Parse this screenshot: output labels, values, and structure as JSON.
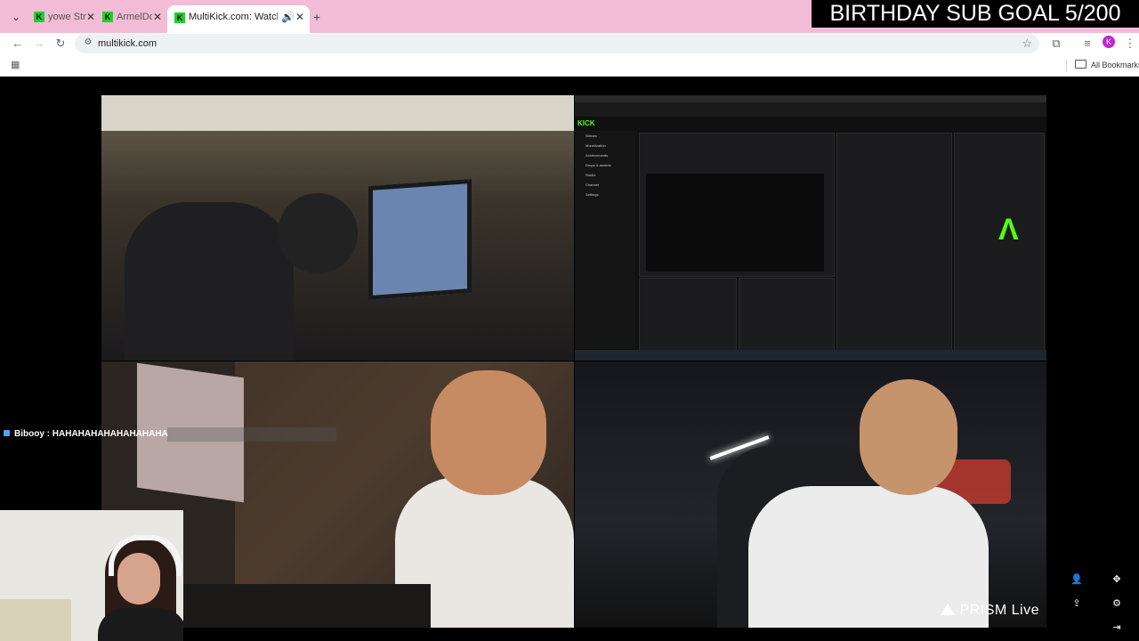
{
  "browser": {
    "tabs": [
      {
        "title": "yowe Str",
        "favicon": "K",
        "active": false
      },
      {
        "title": "ArmelDo",
        "favicon": "K",
        "active": false
      },
      {
        "title": "MultiKick.com: Watch Multi",
        "favicon": "K",
        "active": true
      }
    ],
    "new_tab_symbol": "+",
    "url": "multikick.com",
    "profile_initial": "K",
    "bookmarks_label": "All Bookmarks"
  },
  "overlay": {
    "goal_text": "BIRTHDAY SUB GOAL 5/200",
    "chat": {
      "username": "Bibooy",
      "separator": " : ",
      "message": "HAHAHAHAHAHAHAHAHA"
    },
    "watermark": "PRISM Live"
  },
  "stream2": {
    "brand": "KICK",
    "sidebar": [
      "Stream",
      "Monetization",
      "Achievements",
      "Drops & awards",
      "Studio",
      "Channel",
      "Settings"
    ]
  },
  "colors": {
    "tab_bar": "#f3bcd6",
    "kick_green": "#53fc18",
    "page_bg": "#000000"
  },
  "icons": [
    "tab-search-icon",
    "back-icon",
    "forward-icon",
    "reload-icon",
    "site-info-icon",
    "bookmark-star-icon",
    "extensions-icon",
    "media-icon",
    "menu-icon",
    "apps-icon",
    "folder-icon",
    "add-user-icon",
    "move-icon",
    "share-icon",
    "settings-icon",
    "exit-icon"
  ]
}
